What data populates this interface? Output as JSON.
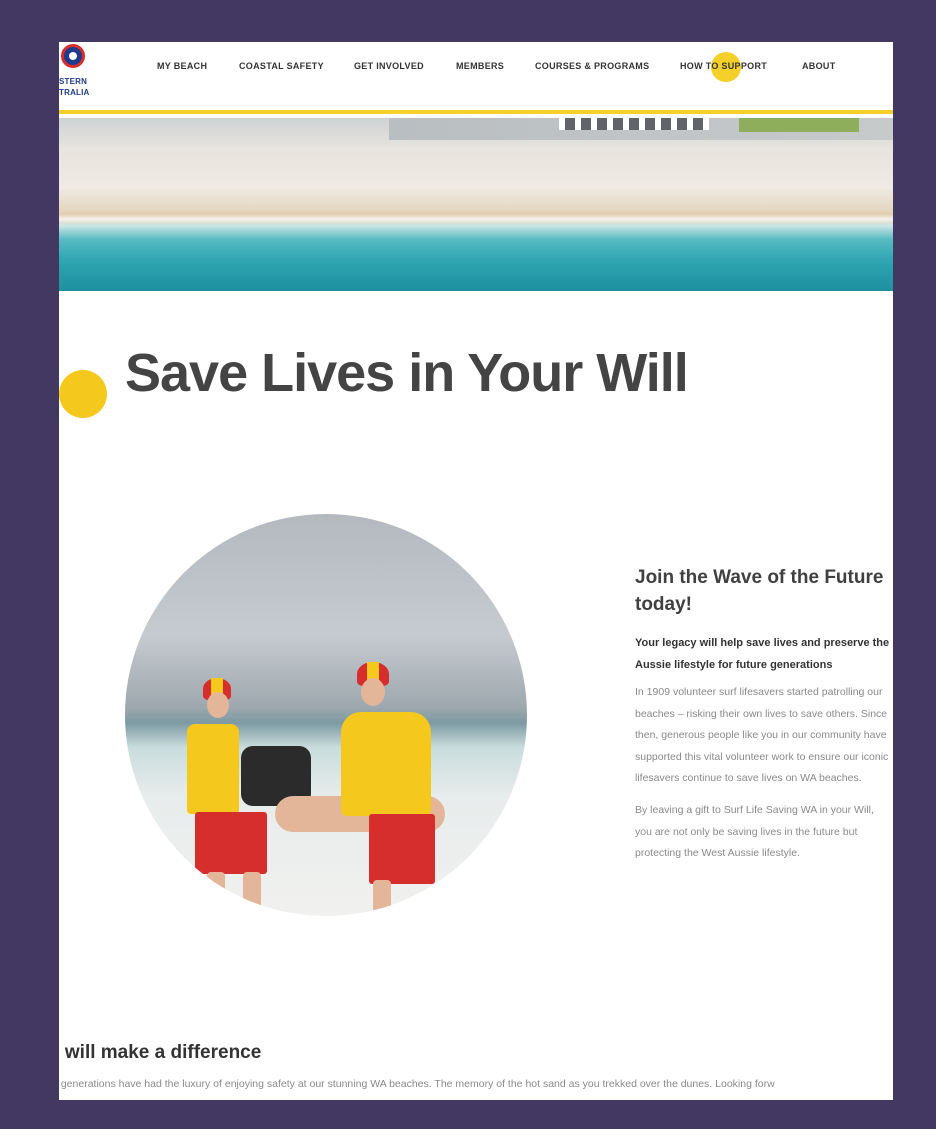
{
  "logo": {
    "line1": "STERN",
    "line2": "TRALIA"
  },
  "nav": {
    "items": [
      {
        "label": "MY BEACH"
      },
      {
        "label": "COASTAL SAFETY"
      },
      {
        "label": "GET INVOLVED"
      },
      {
        "label": "MEMBERS"
      },
      {
        "label": "COURSES & PROGRAMS"
      },
      {
        "label": "HOW TO SUPPORT"
      },
      {
        "label": "ABOUT"
      }
    ]
  },
  "page": {
    "title": "Save Lives in Your Will"
  },
  "section": {
    "title": "Join the Wave of the Future today!",
    "lead": "Your legacy will help save lives and preserve the Aussie lifestyle for future generations",
    "paragraphs": [
      "In 1909 volunteer surf lifesavers started patrolling our beaches – risking their own lives to save others. Since then, generous people like you in our community have supported this vital volunteer work to ensure our iconic lifesavers continue to save lives on WA beaches.",
      "By leaving a gift to Surf Life Saving WA in your Will, you are not only be saving lives in the future but protecting the West Aussie lifestyle."
    ]
  },
  "difference": {
    "title": "u will make a difference",
    "body": "t generations have had the luxury of enjoying safety at our stunning WA beaches. The memory of the hot sand as you trekked over the dunes. Looking forw"
  },
  "colors": {
    "frame": "#433862",
    "accent": "#f5c81e",
    "heading": "#444444",
    "body": "#8a8a8a"
  }
}
